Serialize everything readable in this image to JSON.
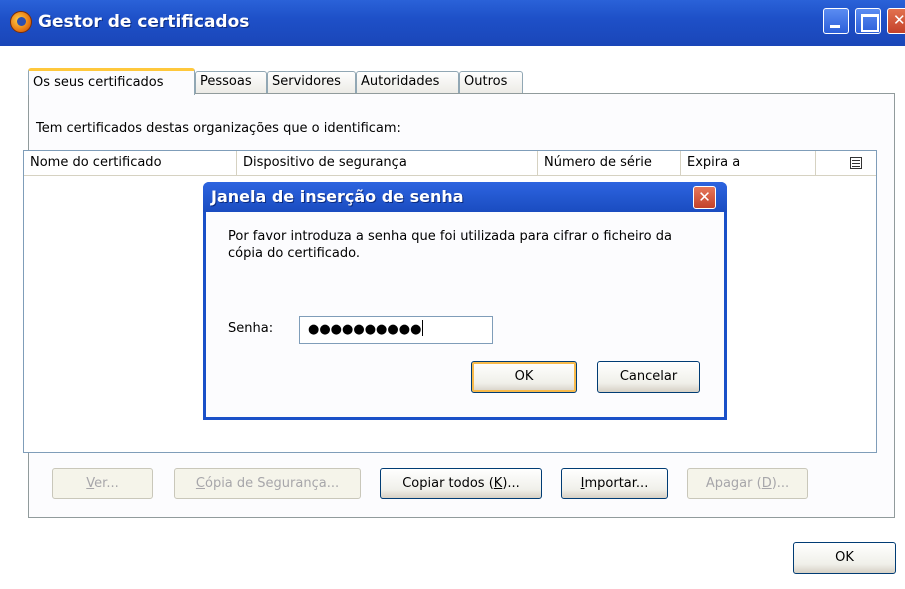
{
  "window": {
    "title": "Gestor de certificados",
    "icon": "firefox-logo-icon",
    "controls": [
      "minimize-icon",
      "maximize-icon",
      "close-icon"
    ]
  },
  "tabs": [
    {
      "label": "Os seus certificados",
      "active": true
    },
    {
      "label": "Pessoas",
      "active": false
    },
    {
      "label": "Servidores",
      "active": false
    },
    {
      "label": "Autoridades",
      "active": false
    },
    {
      "label": "Outros",
      "active": false
    }
  ],
  "panel": {
    "intro": "Tem certificados destas organizações que o identificam:",
    "columns": [
      "Nome do certificado",
      "Dispositivo de segurança",
      "Número de série",
      "Expira a"
    ],
    "column_picker_icon": "column-picker-icon",
    "rows": []
  },
  "buttons": {
    "view": {
      "label": "Ver...",
      "underline": "V",
      "rest": "er...",
      "enabled": false
    },
    "backup": {
      "label": "Cópia de Segurança...",
      "underline": "C",
      "rest": "ópia de Segurança...",
      "enabled": false
    },
    "backup_all_pre": "Copiar todos (",
    "backup_all_key": "K",
    "backup_all_post": ")...",
    "import_key": "I",
    "import_rest": "mportar...",
    "delete_pre": "Apagar (",
    "delete_key": "D",
    "delete_post": ")...",
    "ok": "OK"
  },
  "dialog": {
    "title": "Janela de inserção de senha",
    "message": "Por favor introduza a senha que foi utilizada para cifrar o ficheiro da cópia do certificado.",
    "password_label": "Senha:",
    "password_value": "●●●●●●●●●●",
    "ok": "OK",
    "cancel": "Cancelar"
  },
  "colors": {
    "titlebar": "#1e50c8",
    "tab_active_highlight": "#ffc83c",
    "close_button": "#c4412a",
    "focus_ring": "#f7ba4b"
  }
}
